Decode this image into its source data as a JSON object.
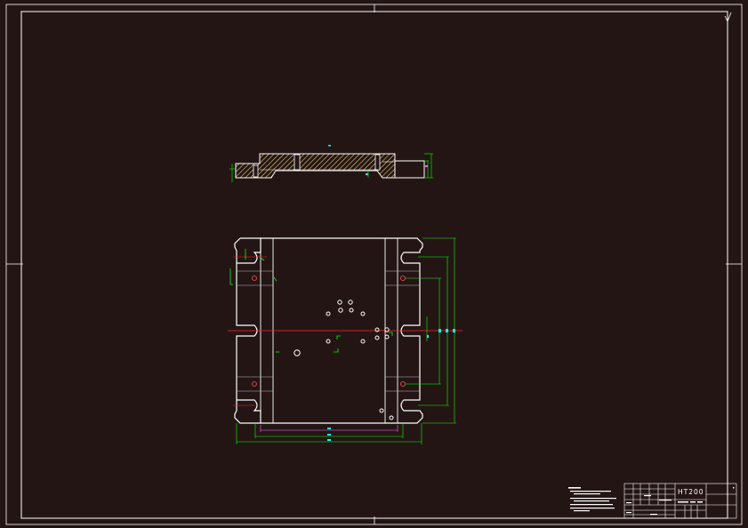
{
  "title_block": {
    "material": "HT200",
    "part_name": "",
    "drawing_code": ""
  },
  "colors": {
    "background": "#241515",
    "frame": "#ffffff",
    "part_outline": "#ffffff",
    "hatch": "#ffff99",
    "dimension": "#00ff00",
    "center_line": "#ff2222",
    "dimension_text": "#00ffff",
    "inner_dim": "#ff66ff"
  }
}
